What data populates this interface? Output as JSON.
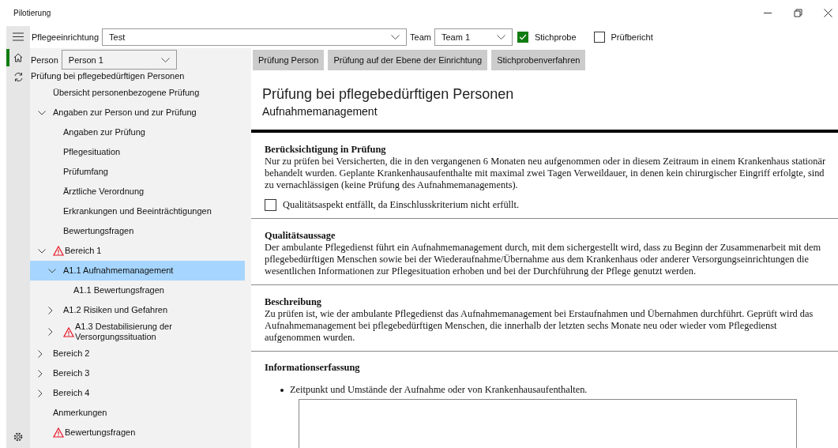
{
  "window": {
    "title": "Pilotierung"
  },
  "toolbar": {
    "facility": {
      "label": "Pflegeeinrichtung",
      "value": "Test"
    },
    "team": {
      "label": "Team",
      "value": "Team 1"
    },
    "checkboxes": [
      {
        "label": "Stichprobe",
        "checked": true
      },
      {
        "label": "Prüfbericht",
        "checked": false
      }
    ]
  },
  "rail": [
    {
      "kind": "home",
      "selected": true
    },
    {
      "kind": "sync",
      "selected": false
    }
  ],
  "person": {
    "label": "Person",
    "value": "Person 1"
  },
  "tree_header": "Prüfung bei pflegebedürftigen Personen",
  "tree": [
    {
      "label": "Übersicht personenbezogene Prüfung",
      "selected": false,
      "warning": false
    },
    {
      "label": "Angaben zur Person und zur Prüfung",
      "selected": false,
      "warning": false,
      "expanded": true,
      "children": [
        {
          "label": "Angaben zur Prüfung",
          "selected": false,
          "warning": false
        },
        {
          "label": "Pflegesituation",
          "selected": false,
          "warning": false
        },
        {
          "label": "Prüfumfang",
          "selected": false,
          "warning": false
        },
        {
          "label": "Ärztliche Verordnung",
          "selected": false,
          "warning": false
        },
        {
          "label": "Erkrankungen und Beeinträchtigungen",
          "selected": false,
          "warning": false
        },
        {
          "label": "Bewertungsfragen",
          "selected": false,
          "warning": false
        }
      ]
    },
    {
      "label": "Bereich 1",
      "selected": false,
      "warning": true,
      "expanded": true,
      "children": [
        {
          "label": "A1.1 Aufnahmemanagement",
          "selected": true,
          "warning": false,
          "expanded": true,
          "children": [
            {
              "label": "A1.1 Bewertungsfragen",
              "selected": false,
              "warning": false
            }
          ]
        },
        {
          "label": "A1.2 Risiken und Gefahren",
          "selected": false,
          "warning": false,
          "expanded": false
        },
        {
          "label": "A1.3 Destabilisierung der Versorgungssituation",
          "selected": false,
          "warning": true,
          "expanded": false
        }
      ]
    },
    {
      "label": "Bereich 2",
      "selected": false,
      "warning": false,
      "expanded": false
    },
    {
      "label": "Bereich 3",
      "selected": false,
      "warning": false,
      "expanded": false
    },
    {
      "label": "Bereich 4",
      "selected": false,
      "warning": false,
      "expanded": false
    },
    {
      "label": "Anmerkungen",
      "selected": false,
      "warning": false
    },
    {
      "label": "Bewertungsfragen",
      "selected": false,
      "warning": true
    }
  ],
  "buttons": [
    "Prüfung Person",
    "Prüfung auf der Ebene der Einrichtung",
    "Stichprobenverfahren"
  ],
  "content": {
    "title": "Prüfung bei pflegebedürftigen Personen",
    "subtitle": "Aufnahmemanagement",
    "sections": [
      {
        "kind": "text",
        "heading": "Berücksichtigung in Prüfung",
        "text": "Nur zu prüfen bei Versicherten, die in den vergangenen 6 Monaten neu aufgenommen oder in diesem Zeitraum in einem Krankenhaus stationär behandelt wurden. Geplante Krankenhausaufenthalte mit maximal zwei Tagen Verweildauer, in denen kein chirurgischer Eingriff erfolgte, sind zu vernachlässigen (keine Prüfung des Aufnahmemanagements).",
        "checkbox": {
          "label": "Qualitätsaspekt entfällt, da Einschlusskriterium nicht erfüllt.",
          "checked": false
        }
      },
      {
        "kind": "text",
        "heading": "Qualitätsaussage",
        "text": "Der ambulante Pflegedienst führt ein Aufnahmemanagement durch, mit dem sichergestellt wird, dass zu Beginn der Zusammenarbeit mit dem pflegebedürftigen Menschen sowie bei der Wiederaufnahme/Übernahme aus dem Krankenhaus oder anderer Versorgungseinrichtungen die wesentlichen Informationen zur Pflegesituation erhoben und bei der Durchführung der Pflege genutzt werden."
      },
      {
        "kind": "text",
        "heading": "Beschreibung",
        "text": "Zu prüfen ist, wie der ambulante Pflegedienst das Aufnahmemanagement bei Erstaufnahmen und Übernahmen durchführt. Geprüft wird das Aufnahmemanagement bei pflegebedürftigen Menschen, die innerhalb der letzten sechs Monate neu oder wieder vom Pflegedienst aufgenommen wurden."
      },
      {
        "kind": "bullets",
        "heading": "Informationserfassung",
        "bullets": [
          "Zeitpunkt und Umstände der Aufnahme oder von Krankenhausaufenthalten."
        ]
      }
    ]
  }
}
